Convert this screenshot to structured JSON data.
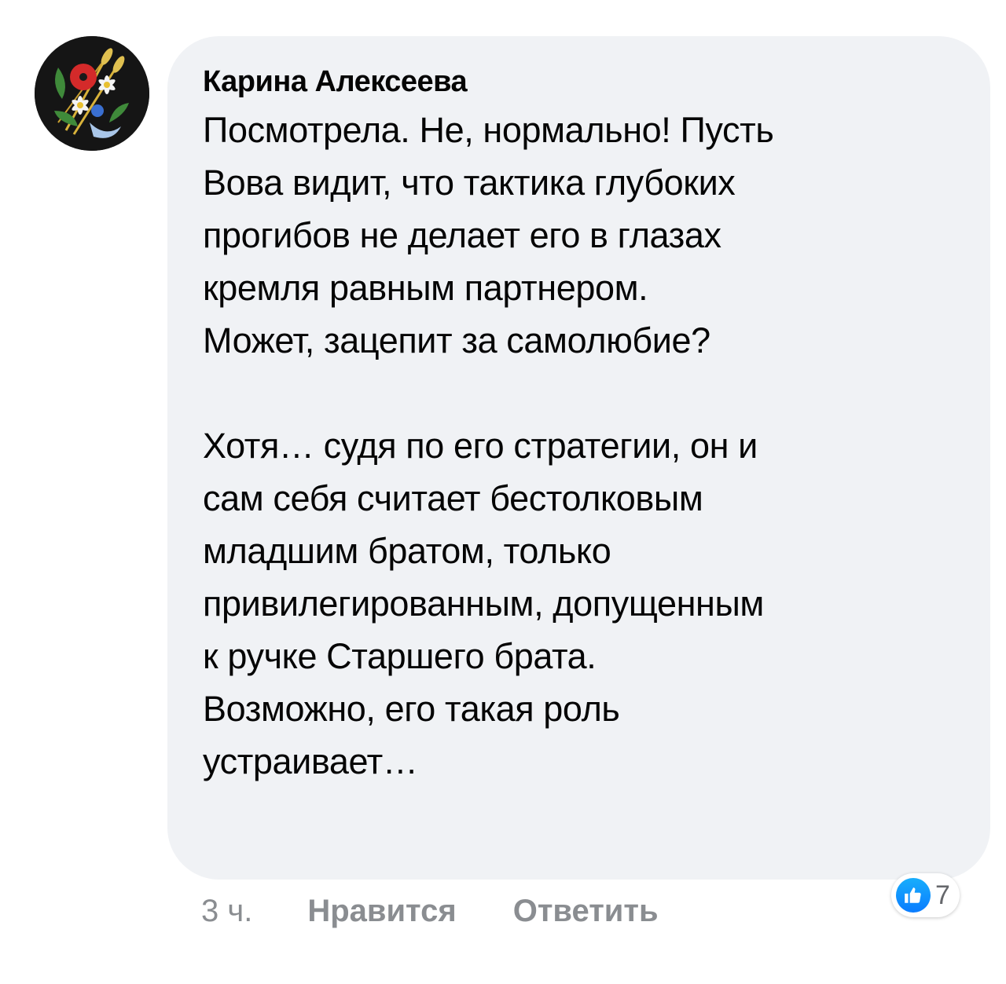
{
  "comment": {
    "author": "Карина Алексеева",
    "avatar_icon": "embroidered-flowers-avatar",
    "paragraphs": [
      [
        "Посмотрела. Не, нормально! Пусть",
        "Вова видит, что тактика глубоких",
        "прогибов не делает его в глазах",
        "кремля равным партнером.",
        "Может, зацепит за самолюбие?"
      ],
      [
        "Хотя… судя по его стратегии, он и",
        "сам себя считает бестолковым",
        "младшим братом, только",
        "привилегированным, допущенным",
        "к ручке Старшего брата.",
        "Возможно, его такая роль",
        "устраивает…"
      ]
    ]
  },
  "actions": {
    "time": "3 ч.",
    "like": "Нравится",
    "reply": "Ответить"
  },
  "reactions": {
    "icon": "like-icon",
    "count": "7",
    "color": "#1877f2"
  },
  "colors": {
    "bubble": "#f0f2f5",
    "text": "#050505",
    "secondary": "#8a8d91"
  }
}
